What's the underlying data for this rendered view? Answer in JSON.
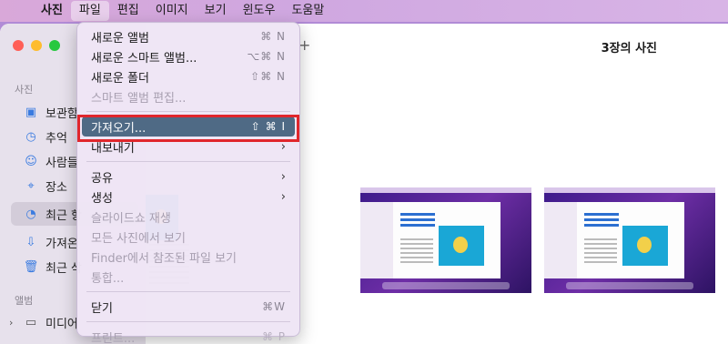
{
  "menubar": {
    "app": "사진",
    "items": [
      "파일",
      "편집",
      "이미지",
      "보기",
      "윈도우",
      "도움말"
    ]
  },
  "sidebar": {
    "section_photos": "사진",
    "items": [
      {
        "label": "보관함",
        "icon": "photo-library-icon"
      },
      {
        "label": "추억",
        "icon": "memories-icon"
      },
      {
        "label": "사람들",
        "icon": "people-icon"
      },
      {
        "label": "장소",
        "icon": "places-icon"
      },
      {
        "label": "최근 항",
        "icon": "clock-icon"
      },
      {
        "label": "가져온",
        "icon": "import-icon"
      },
      {
        "label": "최근 삭",
        "icon": "trash-icon"
      }
    ],
    "section_albums": "앨범",
    "albums": [
      {
        "label": "미디어",
        "icon": "media-stack-icon"
      }
    ]
  },
  "window": {
    "title": "3장의 사진",
    "plus": "+"
  },
  "file_menu": {
    "items": [
      {
        "label": "새로운 앨범",
        "shortcut": "⌘ N",
        "disabled": false
      },
      {
        "label": "새로운 스마트 앨범...",
        "shortcut": "⌥⌘ N",
        "disabled": false
      },
      {
        "label": "새로운 폴더",
        "shortcut": "⇧⌘ N",
        "disabled": false
      },
      {
        "label": "스마트 앨범 편집...",
        "shortcut": "",
        "disabled": true
      },
      {
        "label": "가져오기...",
        "shortcut": "⇧ ⌘ I",
        "disabled": false,
        "highlighted": true
      },
      {
        "label": "내보내기",
        "shortcut": "",
        "submenu": true
      },
      {
        "label": "공유",
        "shortcut": "",
        "submenu": true
      },
      {
        "label": "생성",
        "shortcut": "",
        "submenu": true
      },
      {
        "label": "슬라이드쇼 재생",
        "disabled": true
      },
      {
        "label": "모든 사진에서 보기",
        "disabled": true
      },
      {
        "label": "Finder에서 참조된 파일 보기",
        "disabled": true
      },
      {
        "label": "통합...",
        "disabled": true
      },
      {
        "label": "닫기",
        "shortcut": "⌘W",
        "disabled": false
      },
      {
        "label": "프린트...",
        "shortcut": "⌘ P",
        "disabled": true
      }
    ]
  },
  "colors": {
    "highlight": "#4f6a85",
    "annotation": "#e0262c"
  }
}
